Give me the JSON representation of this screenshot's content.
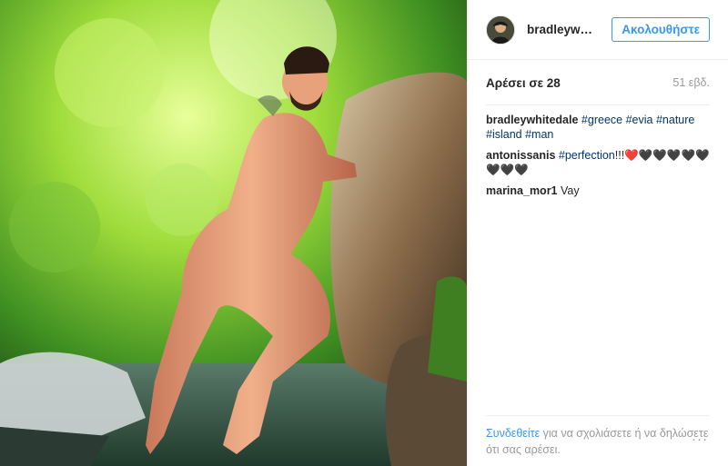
{
  "post": {
    "username": "bradleywhit…",
    "follow_label": "Ακολουθήστε",
    "likes": "Αρέσει σε 28",
    "time": "51 εβδ.",
    "caption": {
      "user": "bradleywhitedale",
      "tags": [
        "#greece",
        "#evia",
        "#nature",
        "#island",
        "#man"
      ]
    },
    "comments": [
      {
        "user": "antonissanis",
        "tag": "#perfection",
        "rest": "!!!❤️🖤🖤🖤🖤🖤🖤🖤🖤"
      },
      {
        "user": "marina_mor1",
        "text": "Vay"
      }
    ],
    "footer": {
      "login_link": "Συνδεθείτε",
      "text": " για να σχολιάσετε ή να δηλώσετε ότι σας αρέσει."
    },
    "more_label": "···"
  },
  "colors": {
    "accent": "#3897f0",
    "hashtag": "#003569",
    "muted": "#999999"
  }
}
